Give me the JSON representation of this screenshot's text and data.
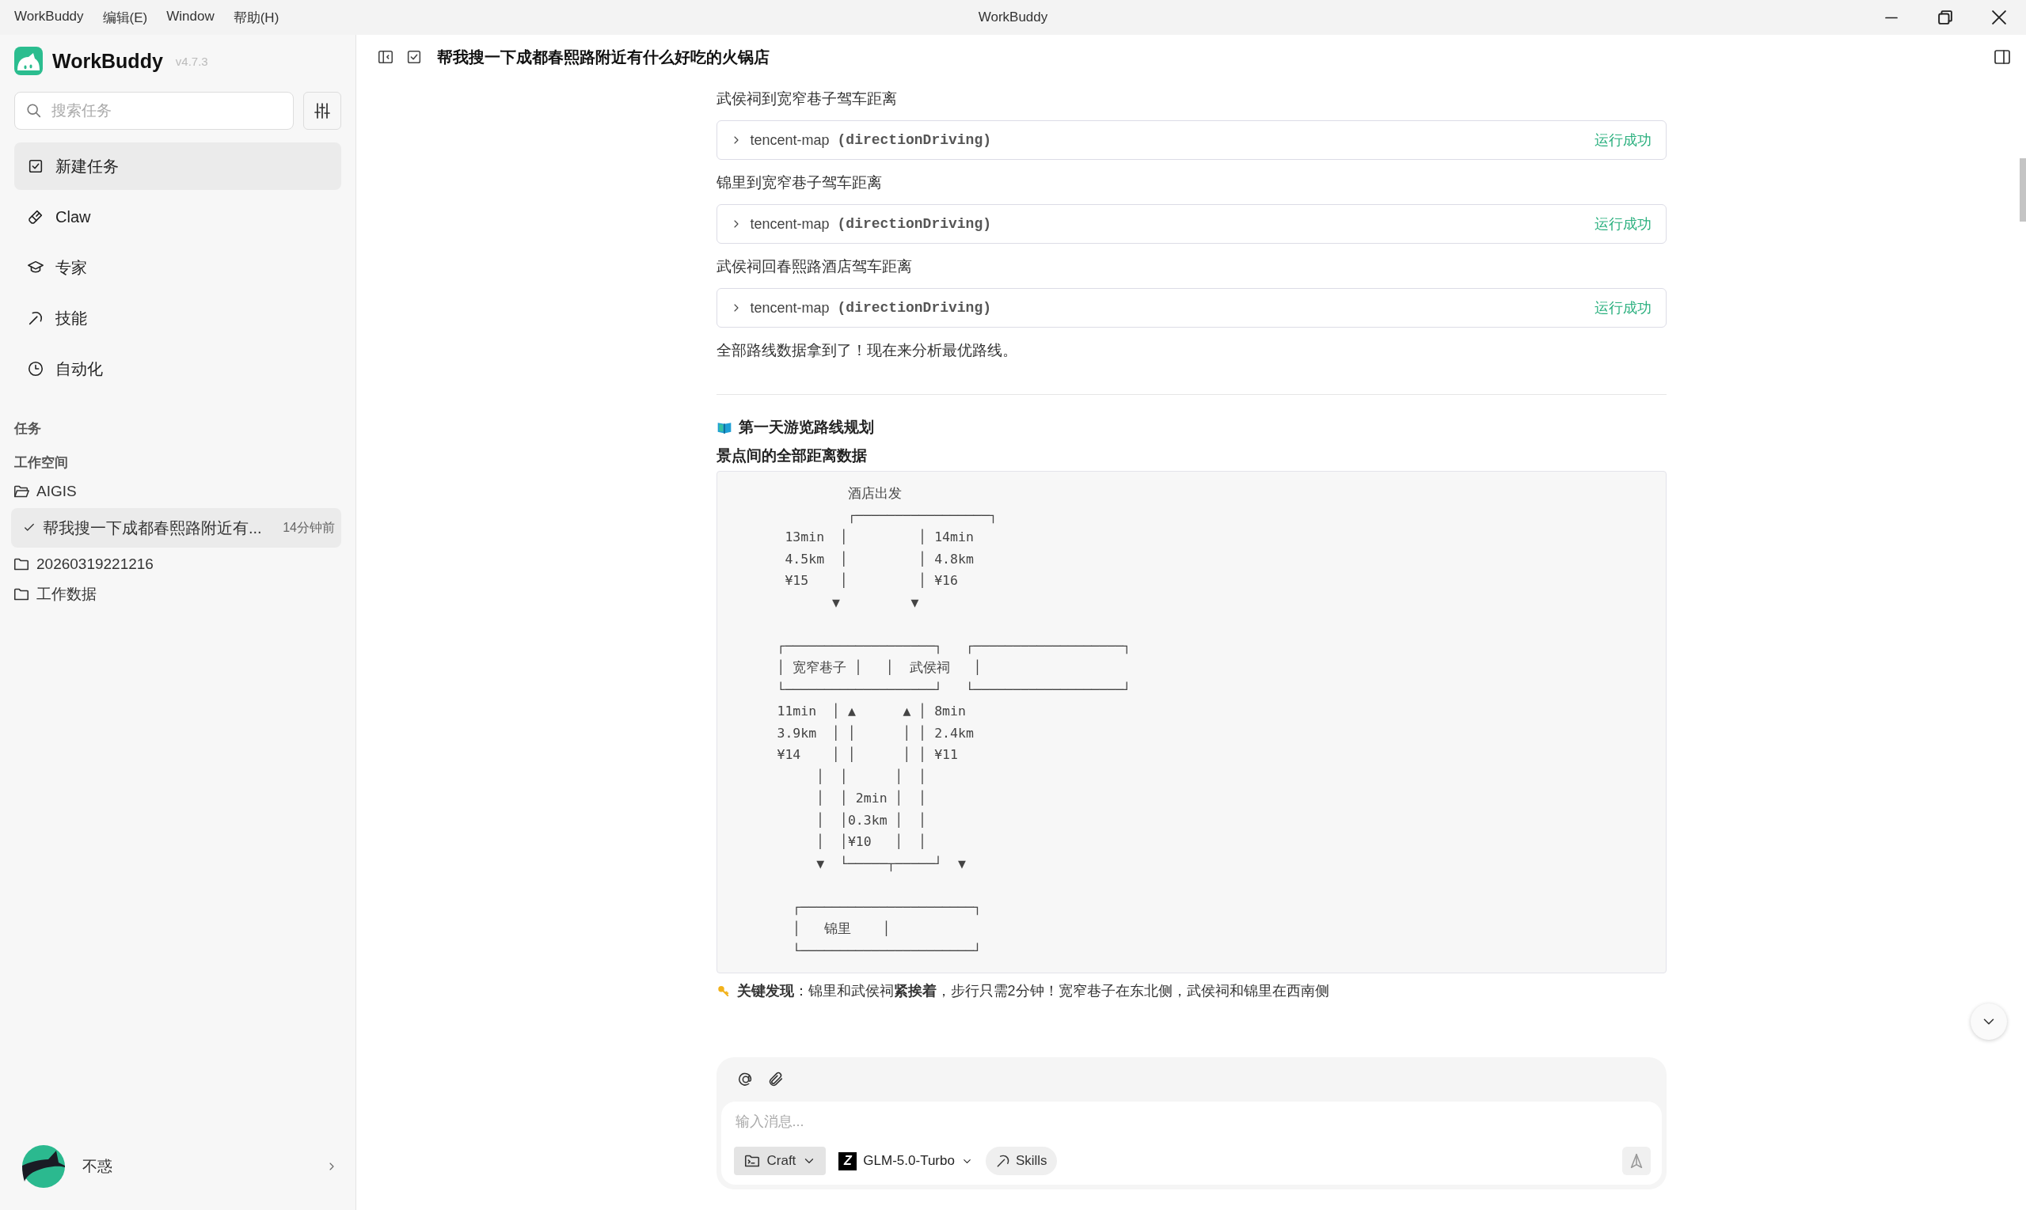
{
  "window": {
    "title": "WorkBuddy"
  },
  "menu": [
    "WorkBuddy",
    "编辑(E)",
    "Window",
    "帮助(H)"
  ],
  "sidebar": {
    "app_name": "WorkBuddy",
    "version": "v4.7.3",
    "search": {
      "placeholder": "搜索任务"
    },
    "nav": [
      {
        "label": "新建任务",
        "selected": true
      },
      {
        "label": "Claw",
        "selected": false
      },
      {
        "label": "专家",
        "selected": false
      },
      {
        "label": "技能",
        "selected": false
      },
      {
        "label": "自动化",
        "selected": false
      }
    ],
    "tasks_heading": "任务",
    "workspace_heading": "工作空间",
    "workspace": [
      {
        "label": "AIGIS",
        "expanded": true,
        "children": [
          {
            "label": "帮我搜一下成都春熙路附近有...",
            "time": "14分钟前",
            "selected": true
          }
        ]
      },
      {
        "label": "20260319221216",
        "expanded": false
      },
      {
        "label": "工作数据",
        "expanded": false
      }
    ],
    "user": {
      "name": "不惑"
    }
  },
  "chat": {
    "title": "帮我搜一下成都春熙路附近有什么好吃的火锅店",
    "items": [
      {
        "kind": "text",
        "text": "武侯祠到宽窄巷子驾车距离"
      },
      {
        "kind": "tool",
        "name": "tencent-map",
        "method": "(directionDriving)",
        "status": "运行成功"
      },
      {
        "kind": "text",
        "text": "锦里到宽窄巷子驾车距离"
      },
      {
        "kind": "tool",
        "name": "tencent-map",
        "method": "(directionDriving)",
        "status": "运行成功"
      },
      {
        "kind": "text",
        "text": "武侯祠回春熙路酒店驾车距离"
      },
      {
        "kind": "tool",
        "name": "tencent-map",
        "method": "(directionDriving)",
        "status": "运行成功"
      },
      {
        "kind": "text",
        "text": "全部路线数据拿到了！现在来分析最优路线。"
      },
      {
        "kind": "rule"
      },
      {
        "kind": "heading",
        "text": "**第一天游览路线规划**"
      },
      {
        "kind": "subheading",
        "text": "**景点间的全部距离数据**"
      },
      {
        "kind": "code",
        "text": "         酒店出发\n         ┌─────────────────┐\n 13min  │         │ 14min\n 4.5km  │         │ 4.8km\n ¥15    │         │ ¥16\n       ▼         ▼\n\n┌───────────────────┐   ┌───────────────────┐\n│ 宽窄巷子 │   │  武侯祠   │\n└───────────────────┘   └───────────────────┘\n11min  │ ▲      ▲ │ 8min\n3.9km  │ │      │ │ 2.4km\n¥14    │ │      │ │ ¥11\n     │  │      │  │\n     │  │ 2min │  │\n     │  │0.3km │  │\n     │  │¥10   │  │\n     ▼  └─────┬─────┘  ▼\n\n  ┌──────────────────────┐\n  │   锦里    │\n  └──────────────────────┘"
      },
      {
        "kind": "callout",
        "text": "**关键发现**：锦里和武侯祠**紧挨着**，步行只需2分钟！宽窄巷子在东北侧，武侯祠和锦里在西南侧"
      }
    ]
  },
  "composer": {
    "placeholder": "输入消息...",
    "mode": "Craft",
    "model_logo": "Z",
    "model": "GLM-5.0-Turbo",
    "skills": "Skills"
  }
}
